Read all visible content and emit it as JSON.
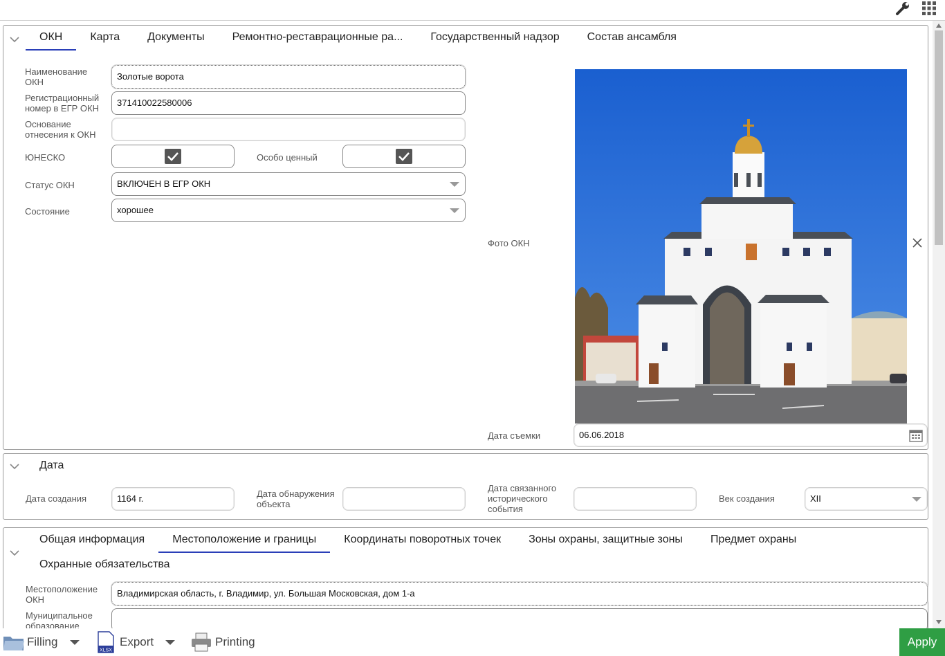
{
  "icons": {
    "settings": "wrench-icon",
    "apps": "grid-icon",
    "collapse": "chevron-down-icon",
    "close": "close-icon",
    "calendar": "calendar-icon",
    "filling": "folder-icon",
    "export": "xlsx-icon",
    "printing": "printer-icon"
  },
  "colors": {
    "accent": "#2a3fb8",
    "apply": "#2f9e44",
    "sky": "#1a5fd0"
  },
  "okn_tabs": [
    "ОКН",
    "Карта",
    "Документы",
    "Ремонтно-реставрационные ра...",
    "Государственный надзор",
    "Состав ансамбля"
  ],
  "form": {
    "name_label": "Наименование ОКН",
    "name_value": "Золотые ворота",
    "reg_label": "Регистрационный номер в ЕГР ОКН",
    "reg_value": "371410022580006",
    "basis_label": "Основание отнесения к ОКН",
    "basis_value": "",
    "unesco_label": "ЮНЕСКО",
    "unesco_checked": true,
    "valuable_label": "Особо ценный",
    "valuable_checked": true,
    "status_label": "Статус ОКН",
    "status_value": "ВКЛЮЧЕН В ЕГР ОКН",
    "state_label": "Состояние",
    "state_value": "хорошее",
    "photo_label": "Фото ОКН",
    "shoot_date_label": "Дата съемки",
    "shoot_date_value": "06.06.2018"
  },
  "date_section": {
    "title": "Дата",
    "created_label": "Дата создания",
    "created_value": "1164 г.",
    "discovered_label": "Дата обнаружения объекта",
    "discovered_value": "",
    "event_label": "Дата связанного исторического события",
    "event_value": "",
    "century_label": "Век создания",
    "century_value": "XII"
  },
  "info_tabs": [
    "Общая информация",
    "Местоположение и границы",
    "Координаты поворотных точек",
    "Зоны охраны, защитные зоны",
    "Предмет охраны",
    "Охранные обязательства"
  ],
  "location": {
    "location_label": "Местоположение ОКН",
    "location_value": "Владимирская область, г. Владимир, ул. Большая Московская, дом 1-а",
    "municipal_label": "Муниципальное образование",
    "municipal_value": ""
  },
  "bottom": {
    "filling": "Filling",
    "export": "Export",
    "printing": "Printing",
    "apply": "Apply"
  }
}
